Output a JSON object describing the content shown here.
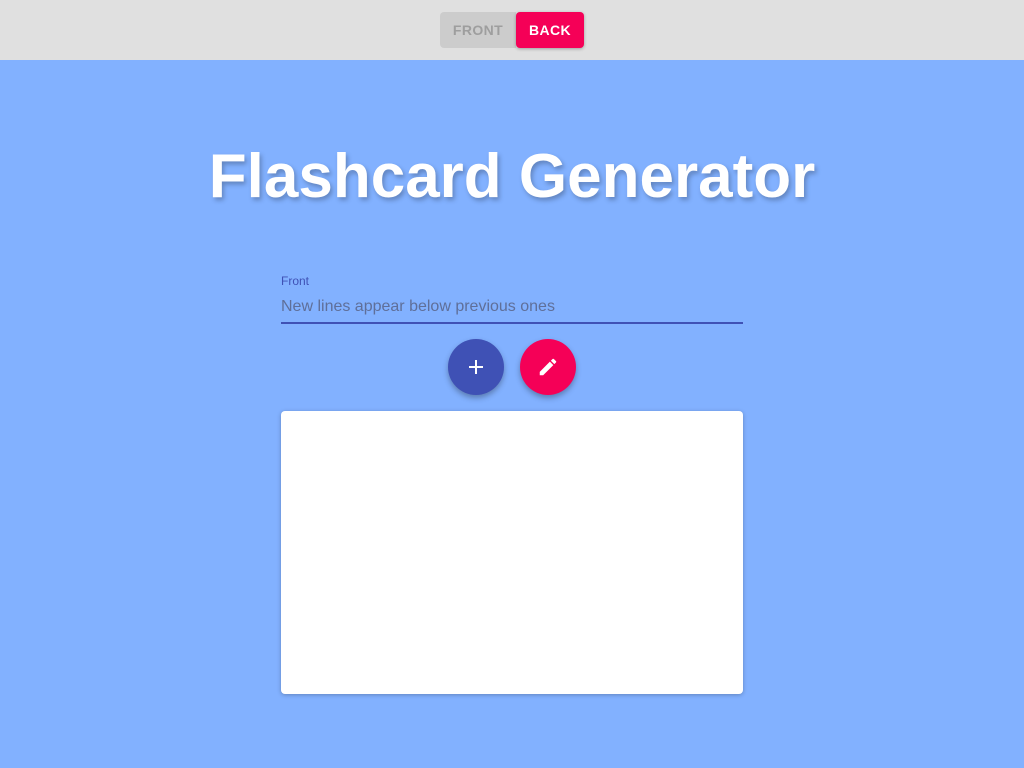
{
  "toolbar": {
    "front_label": "FRONT",
    "back_label": "BACK",
    "active": "back"
  },
  "header": {
    "title": "Flashcard Generator"
  },
  "form": {
    "field_label": "Front",
    "placeholder": "New lines appear below previous ones",
    "value": ""
  },
  "actions": {
    "add_icon": "plus-icon",
    "edit_icon": "pencil-icon"
  },
  "colors": {
    "background": "#82b1ff",
    "topbar": "#e0e0e0",
    "primary": "#3f51b5",
    "accent": "#f50057"
  }
}
